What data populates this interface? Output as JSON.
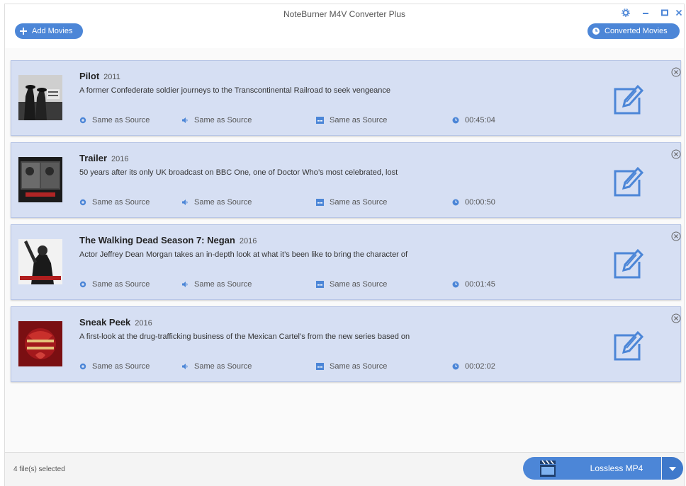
{
  "app": {
    "title": "NoteBurner M4V Converter Plus"
  },
  "toolbar": {
    "add_movies_label": "Add Movies",
    "converted_movies_label": "Converted Movies"
  },
  "window_controls": [
    "settings-icon",
    "minimize-icon",
    "maximize-icon",
    "close-icon"
  ],
  "movies": [
    {
      "title": "Pilot",
      "year": "2011",
      "description": "A former Confederate soldier journeys to the Transcontinental Railroad to seek vengeance",
      "video": "Same as Source",
      "audio": "Same as Source",
      "subtitle": "Same as Source",
      "duration": "00:45:04"
    },
    {
      "title": "Trailer",
      "year": "2016",
      "description": "50 years after its only UK broadcast on BBC One, one of Doctor Who’s most celebrated, lost",
      "video": "Same as Source",
      "audio": "Same as Source",
      "subtitle": "Same as Source",
      "duration": "00:00:50"
    },
    {
      "title": "The Walking Dead Season 7: Negan",
      "year": "2016",
      "description": "Actor Jeffrey Dean Morgan takes an in-depth look at what it’s been like to bring the character of",
      "video": "Same as Source",
      "audio": "Same as Source",
      "subtitle": "Same as Source",
      "duration": "00:01:45"
    },
    {
      "title": "Sneak Peek",
      "year": "2016",
      "description": "A first-look at the drug-trafficking business of the Mexican Cartel’s from the new series based on",
      "video": "Same as Source",
      "audio": "Same as Source",
      "subtitle": "Same as Source",
      "duration": "00:02:02"
    }
  ],
  "status": {
    "selected_count": "4 file(s) selected"
  },
  "output": {
    "format_label": "Lossless MP4"
  },
  "colors": {
    "accent": "#4c86d7",
    "card_bg": "#d6dff3"
  }
}
